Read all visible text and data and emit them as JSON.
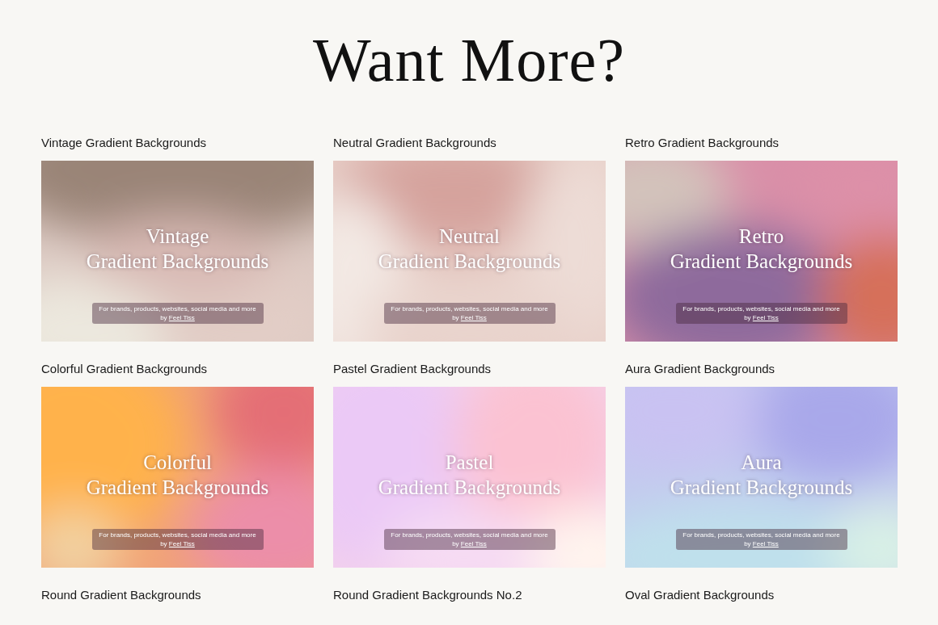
{
  "heading": "Want More?",
  "products": [
    {
      "label": "Vintage Gradient Backgrounds",
      "overlay_lines": [
        "Vintage",
        "Gradient Backgrounds"
      ],
      "tagline": "For brands, products, websites, social media and more by",
      "link": "Feel Tiss"
    },
    {
      "label": "Neutral Gradient Backgrounds",
      "overlay_lines": [
        "Neutral",
        "Gradient Backgrounds"
      ],
      "tagline": "For brands, products, websites, social media and more by",
      "link": "Feel Tiss"
    },
    {
      "label": "Retro Gradient Backgrounds",
      "overlay_lines": [
        "Retro",
        "Gradient Backgrounds"
      ],
      "tagline": "For brands, products, websites, social media and more by",
      "link": "Feel Tiss"
    },
    {
      "label": "Colorful Gradient Backgrounds",
      "overlay_lines": [
        "Colorful",
        "Gradient Backgrounds"
      ],
      "tagline": "For brands, products, websites, social media and more by",
      "link": "Feel Tiss"
    },
    {
      "label": "Pastel Gradient Backgrounds",
      "overlay_lines": [
        "Pastel",
        "Gradient Backgrounds"
      ],
      "tagline": "For brands, products, websites, social media and more by",
      "link": "Feel Tiss"
    },
    {
      "label": "Aura Gradient Backgrounds",
      "overlay_lines": [
        "Aura",
        "Gradient Backgrounds"
      ],
      "tagline": "For brands, products, websites, social media and more by",
      "link": "Feel Tiss"
    },
    {
      "label": "Round Gradient Backgrounds"
    },
    {
      "label": "Round Gradient Backgrounds No.2"
    },
    {
      "label": "Oval Gradient Backgrounds"
    }
  ]
}
